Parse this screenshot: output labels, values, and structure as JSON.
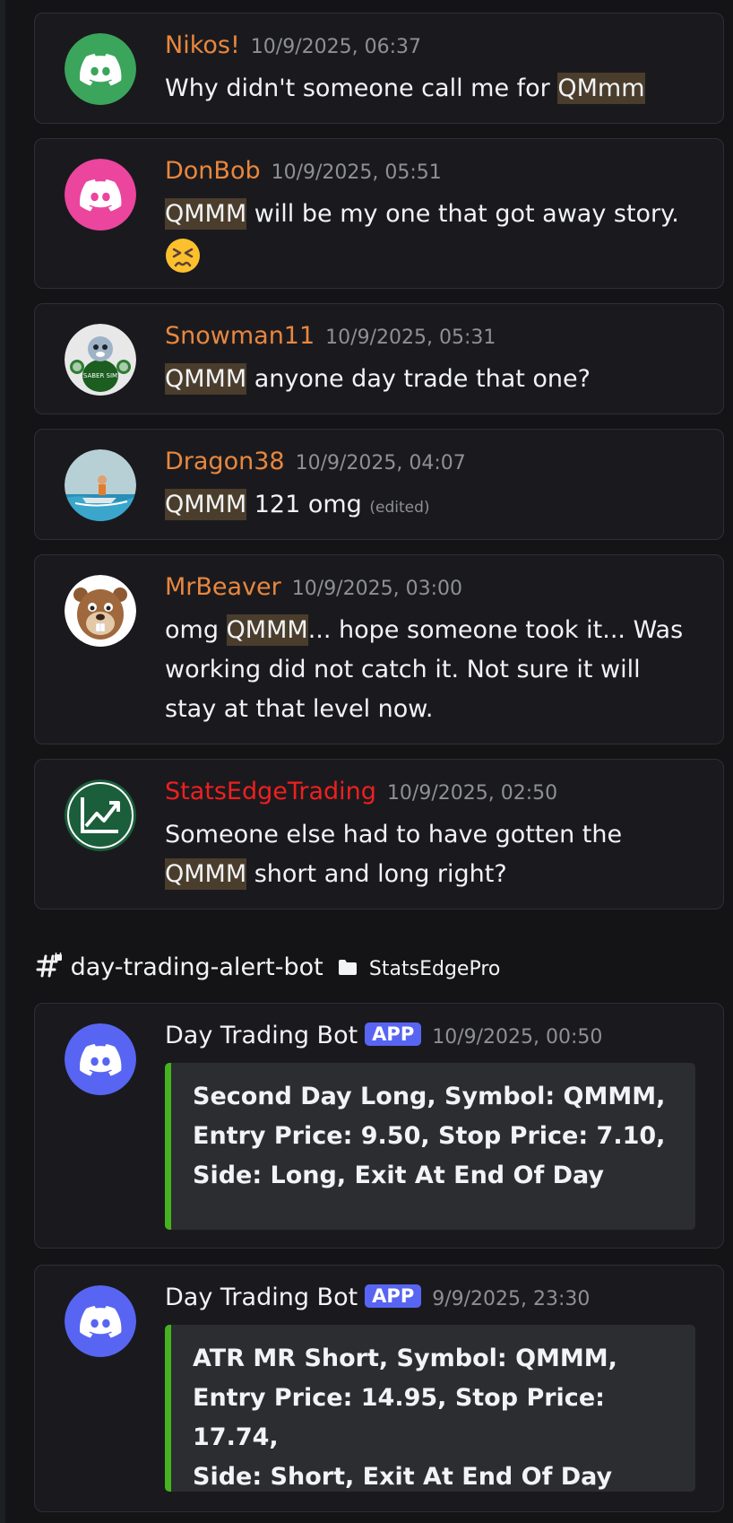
{
  "messages": [
    {
      "author": "Nikos!",
      "timestamp": "10/9/2025, 06:37",
      "text_pre": "Why didn't someone call me for ",
      "ticker": "QMmm",
      "text_post": ""
    },
    {
      "author": "DonBob",
      "timestamp": "10/9/2025, 05:51",
      "ticker": "QMMM",
      "text_post": " will be my one that got away story.",
      "emoji": "😣"
    },
    {
      "author": "Snowman11",
      "timestamp": "10/9/2025, 05:31",
      "ticker": "QMMM",
      "text_post": " anyone day trade that one?",
      "avatar_text": "SABER SIM"
    },
    {
      "author": "Dragon38",
      "timestamp": "10/9/2025, 04:07",
      "ticker": "QMMM",
      "text_post": " 121 omg ",
      "edited": "(edited)"
    },
    {
      "author": "MrBeaver",
      "timestamp": "10/9/2025, 03:00",
      "text_pre": "omg ",
      "ticker": "QMMM",
      "text_post_1": "...  hope someone took it... Was",
      "text_line_2": "working did not catch it.  Not sure it will",
      "text_line_3": "stay at that level now."
    },
    {
      "author": "StatsEdgeTrading",
      "timestamp": "10/9/2025, 02:50",
      "text_line_1": "Someone else had to have gotten the",
      "ticker": "QMMM",
      "text_post": " short and long right?"
    }
  ],
  "channel": {
    "hash": "#",
    "name": "day-trading-alert-bot",
    "category": "StatsEdgePro"
  },
  "bot_messages": [
    {
      "author": "Day Trading Bot",
      "badge": "APP",
      "timestamp": "10/9/2025, 00:50",
      "lines": [
        "Second Day Long, Symbol: QMMM,",
        "Entry Price: 9.50, Stop Price: 7.10,",
        "Side: Long, Exit At End Of Day"
      ]
    },
    {
      "author": "Day Trading Bot",
      "badge": "APP",
      "timestamp": "9/9/2025, 23:30",
      "lines": [
        "ATR MR Short, Symbol: QMMM,",
        "Entry Price: 14.95, Stop Price: 17.74,",
        "Side: Short, Exit At End Of Day"
      ]
    }
  ],
  "colors": {
    "author_orange": "#e9873e",
    "author_red": "#f01f1f",
    "highlight": "#4a3d2c",
    "embed_border": "#45b21f",
    "app_badge": "#5865f2",
    "avatar_green": "#3ba55c",
    "avatar_pink": "#eb459e",
    "avatar_blurple": "#5865f2"
  },
  "icons": [
    "discord-logo-icon",
    "folder-icon",
    "lock-hash-icon",
    "trend-chart-icon"
  ]
}
